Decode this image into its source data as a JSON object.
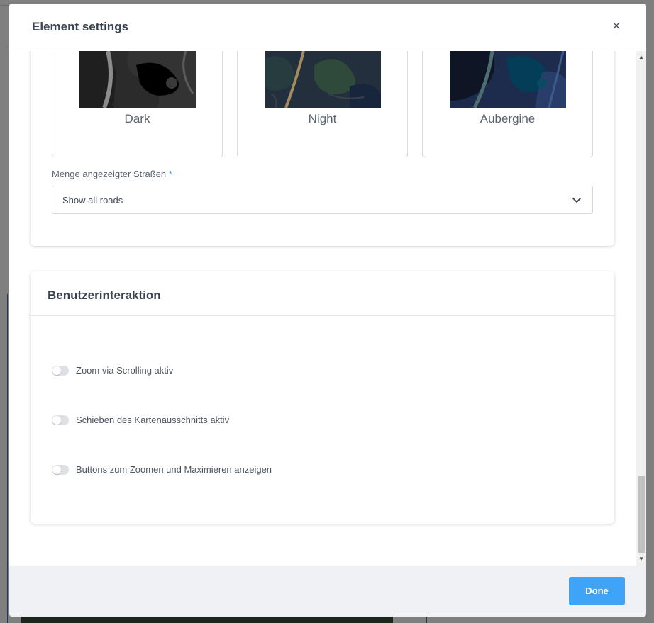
{
  "modal": {
    "title": "Element settings",
    "close_icon": "close-icon"
  },
  "map_styles": [
    {
      "label": "Dark"
    },
    {
      "label": "Night"
    },
    {
      "label": "Aubergine"
    }
  ],
  "roads_field": {
    "label": "Menge angezeigter Straßen",
    "required_marker": "*",
    "value": "Show all roads",
    "icon": "chevron-down-icon"
  },
  "interaction_section": {
    "title": "Benutzerinteraktion",
    "toggles": [
      {
        "label": "Zoom via Scrolling aktiv",
        "enabled": false
      },
      {
        "label": "Schieben des Kartenausschnitts aktiv",
        "enabled": false
      },
      {
        "label": "Buttons zum Zoomen und Maximieren anzeigen",
        "enabled": false
      }
    ]
  },
  "footer": {
    "done_label": "Done"
  },
  "colors": {
    "accent": "#3fa3f6",
    "required": "#3d8fe0",
    "toggle_off": "#dde0e5"
  }
}
